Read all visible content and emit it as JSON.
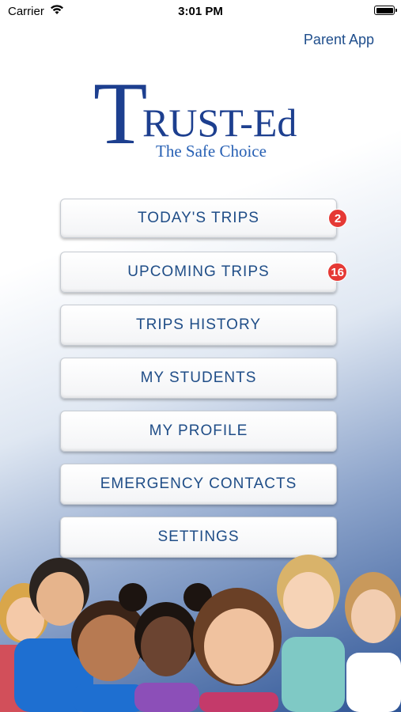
{
  "status_bar": {
    "carrier": "Carrier",
    "time": "3:01 PM"
  },
  "header": {
    "app_link": "Parent App"
  },
  "logo": {
    "first_letter": "T",
    "rest": "RUST-Ed",
    "tagline": "The Safe Choice"
  },
  "menu": [
    {
      "label": "TODAY'S TRIPS",
      "badge": "2"
    },
    {
      "label": "UPCOMING TRIPS",
      "badge": "16"
    },
    {
      "label": "TRIPS HISTORY"
    },
    {
      "label": "MY STUDENTS"
    },
    {
      "label": "MY PROFILE"
    },
    {
      "label": "EMERGENCY CONTACTS"
    },
    {
      "label": "SETTINGS"
    }
  ],
  "colors": {
    "primary": "#1d3f8f",
    "badge": "#e53935",
    "link": "#1f4e8c"
  }
}
